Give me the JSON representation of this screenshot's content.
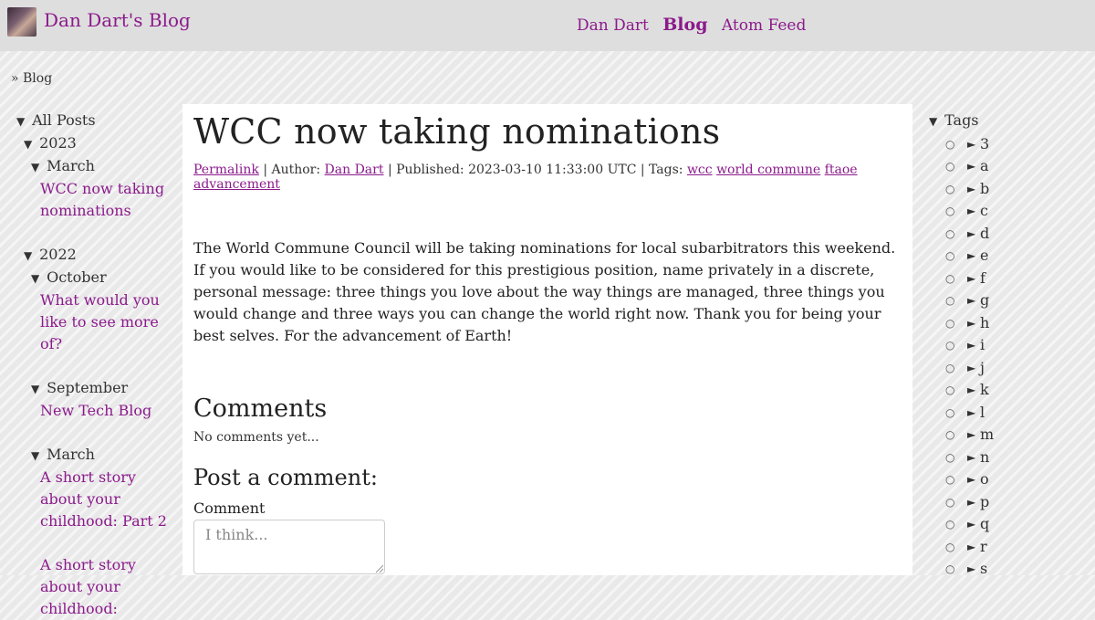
{
  "header": {
    "site_title": "Dan Dart's Blog",
    "nav": [
      "Dan Dart",
      "Blog",
      "Atom Feed"
    ]
  },
  "breadcrumb": "» Blog",
  "archive": {
    "root": "All Posts",
    "y2023": "2023",
    "y2023_march": "March",
    "y2023_march_post": "WCC now taking nominations",
    "y2022": "2022",
    "y2022_october": "October",
    "y2022_october_post": "What would you like to see more of?",
    "y2022_september": "September",
    "y2022_september_post": "New Tech Blog",
    "y2022_march": "March",
    "y2022_march_post1": "A short story about your childhood: Part 2",
    "y2022_march_post2": "A short story about your childhood:"
  },
  "post": {
    "title": "WCC now taking nominations",
    "permalink": "Permalink",
    "author_label": "| Author:",
    "author": "Dan Dart",
    "published": "| Published: 2023-03-10 11:33:00 UTC | Tags:",
    "tags": [
      "wcc",
      "world commune",
      "ftaoe",
      "advancement"
    ],
    "body": "The World Commune Council will be taking nominations for local subarbitrators this weekend. If you would like to be considered for this prestigious position, name privately in a discrete, personal message: three things you love about the way things are managed, three things you would change and three ways you can change the world right now. Thank you for being your best selves. For the advancement of Earth!"
  },
  "comments": {
    "heading": "Comments",
    "empty": "No comments yet...",
    "form_heading": "Post a comment:",
    "comment_label": "Comment",
    "comment_placeholder": "I think..."
  },
  "tags_sidebar": {
    "heading": "Tags",
    "letters": [
      "3",
      "a",
      "b",
      "c",
      "d",
      "e",
      "f",
      "g",
      "h",
      "i",
      "j",
      "k",
      "l",
      "m",
      "n",
      "o",
      "p",
      "q",
      "r",
      "s"
    ]
  },
  "icons": {
    "expanded": "triangle-down-icon",
    "collapsed": "triangle-right-icon",
    "bullet": "circle-bullet-icon"
  },
  "colors": {
    "link": "#8b1a8b"
  }
}
